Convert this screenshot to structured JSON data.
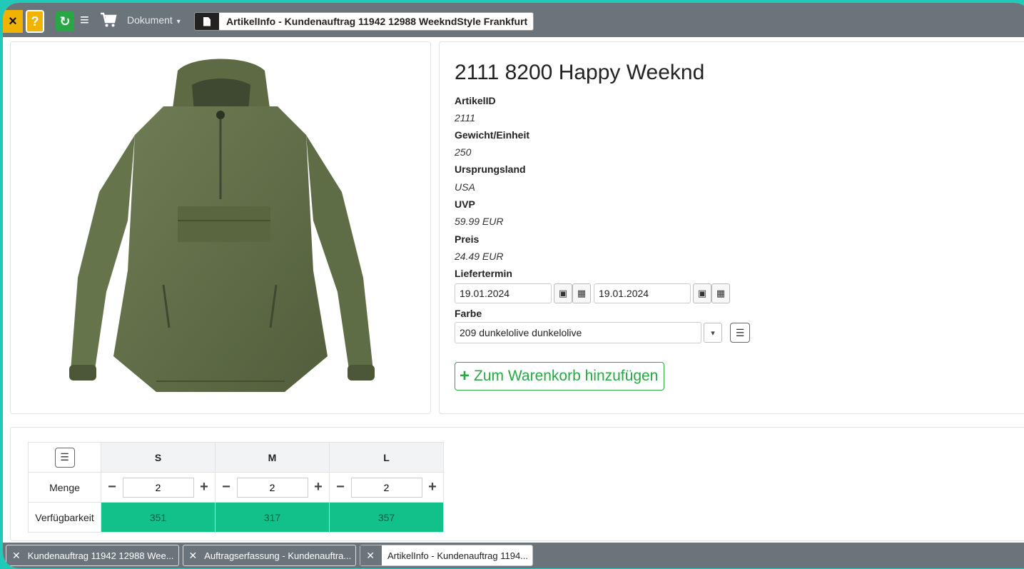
{
  "toolbar": {
    "close_label": "×",
    "help_label": "?",
    "refresh_label": "↻",
    "menu_label": "≡",
    "document_dropdown": "Dokument",
    "active_document": "ArtikelInfo - Kundenauftrag 11942 12988 WeekndStyle Frankfurt"
  },
  "product": {
    "title": "2111 8200 Happy Weeknd",
    "fields": [
      {
        "label": "ArtikelID",
        "value": "2111"
      },
      {
        "label": "Gewicht/Einheit",
        "value": "250"
      },
      {
        "label": "Ursprungsland",
        "value": "USA"
      },
      {
        "label": "UVP",
        "value": "59.99 EUR"
      },
      {
        "label": "Preis",
        "value": "24.49 EUR"
      }
    ],
    "liefertermin_label": "Liefertermin",
    "liefertermin_from": "19.01.2024",
    "liefertermin_to": "19.01.2024",
    "farbe_label": "Farbe",
    "farbe_value": "209 dunkelolive dunkelolive",
    "add_to_cart": "Zum Warenkorb hinzufügen"
  },
  "size_grid": {
    "columns": [
      "S",
      "M",
      "L"
    ],
    "row_menge_label": "Menge",
    "row_avail_label": "Verfügbarkeit",
    "menge": [
      "2",
      "2",
      "2"
    ],
    "availability": [
      "351",
      "317",
      "357"
    ]
  },
  "bottom_tabs": [
    {
      "label": "Kundenauftrag 11942 12988 Wee..."
    },
    {
      "label": "Auftragserfassung - Kundenauftra..."
    },
    {
      "label": "ArtikelInfo - Kundenauftrag 1194..."
    }
  ],
  "colors": {
    "accent_yellow": "#f0b400",
    "accent_green": "#28a745",
    "availability_green": "#12c08a",
    "toolbar_gray": "#6b737b"
  }
}
